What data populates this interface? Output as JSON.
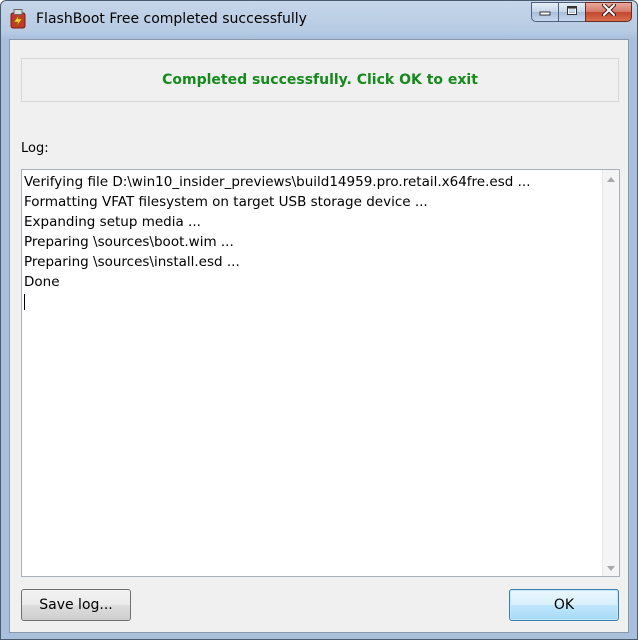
{
  "window": {
    "title": "FlashBoot Free completed successfully",
    "app_icon": "flashboot-usb-icon",
    "caption_buttons": [
      "minimize-icon",
      "maximize-icon",
      "close-icon"
    ]
  },
  "status": {
    "message": "Completed successfully. Click OK to exit",
    "color": "#138a1b"
  },
  "log": {
    "label": "Log:",
    "lines": [
      "Verifying file D:\\win10_insider_previews\\build14959.pro.retail.x64fre.esd ...",
      "Formatting VFAT filesystem on target USB storage device ...",
      "Expanding setup media ...",
      "Preparing \\sources\\boot.wim ...",
      "Preparing \\sources\\install.esd ...",
      "Done"
    ]
  },
  "buttons": {
    "save_log": "Save log...",
    "ok": "OK"
  }
}
